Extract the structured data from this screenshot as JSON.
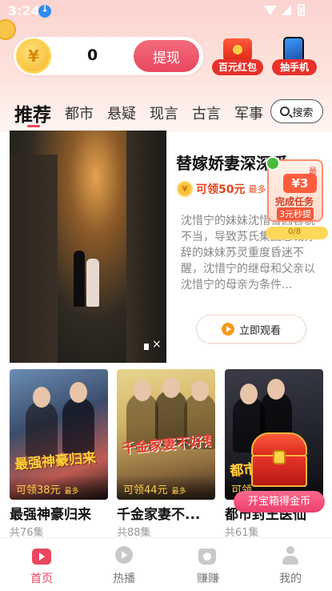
{
  "status_bar": {
    "time": "3:24"
  },
  "wallet": {
    "coin_symbol": "¥",
    "coin_count": "0",
    "withdraw_label": "提现"
  },
  "promos": [
    {
      "label": "百元红包",
      "icon": "red-envelope-icon"
    },
    {
      "label": "抽手机",
      "icon": "phone-prize-icon"
    }
  ],
  "category_tabs": [
    {
      "label": "推荐",
      "active": true
    },
    {
      "label": "都市"
    },
    {
      "label": "悬疑"
    },
    {
      "label": "现言"
    },
    {
      "label": "古言"
    },
    {
      "label": "军事"
    }
  ],
  "search": {
    "label": "搜索",
    "icon": "search-icon"
  },
  "featured": {
    "title": "替嫁娇妻深深爱",
    "coin_symbol": "¥",
    "reward": "可领50元",
    "reward_suffix": "最多",
    "description": "沈惜宁的妹妹沈惜雪因容貌不当，导致苏氏集团总裁苏辞的妹妹苏灵重度昏迷不醒，沈惜宁的继母和父亲以沈惜宁的母亲为条件...",
    "watch_label": "立即观看"
  },
  "task_widget": {
    "badge": "最高",
    "amount": "¥3",
    "line1": "完成任务",
    "line2": "3元秒提",
    "progress": "0/8"
  },
  "cards": [
    {
      "poster_text": "最强神豪归来",
      "reward": "可领38元",
      "reward_suffix": "最多",
      "title": "最强神豪归来",
      "episodes": "共76集"
    },
    {
      "poster_text": "千金家妻不好惹",
      "reward": "可领44元",
      "reward_suffix": "最多",
      "title": "千金家妻不...",
      "episodes": "共88集"
    },
    {
      "poster_text": "都市",
      "reward": "可领",
      "reward_suffix": "",
      "title": "都市封王医仙",
      "episodes": "共61集"
    }
  ],
  "treasure": {
    "label": "开宝箱得金币"
  },
  "bottom_nav": [
    {
      "label": "首页",
      "icon": "home-play-icon",
      "active": true
    },
    {
      "label": "热播",
      "icon": "hot-play-icon"
    },
    {
      "label": "赚赚",
      "icon": "earn-wallet-icon"
    },
    {
      "label": "我的",
      "icon": "profile-icon"
    }
  ],
  "colors": {
    "accent": "#e9475f",
    "reward": "#e6441e",
    "gold": "#f9c23c"
  }
}
